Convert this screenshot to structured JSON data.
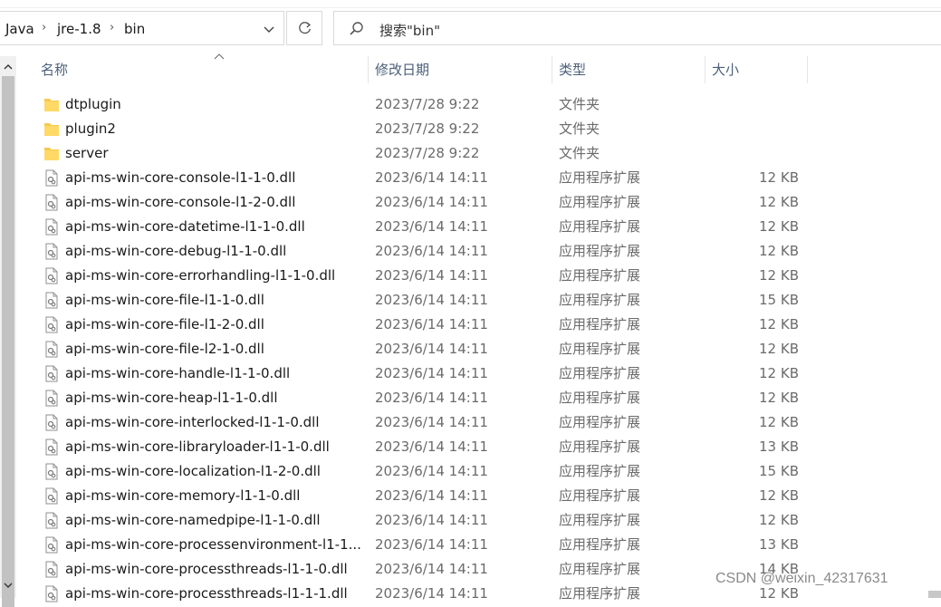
{
  "breadcrumb": [
    "Java",
    "jre-1.8",
    "bin"
  ],
  "search": {
    "placeholder": "搜索\"bin\""
  },
  "columns": {
    "name": "名称",
    "date": "修改日期",
    "type": "类型",
    "size": "大小"
  },
  "files": [
    {
      "name": "dtplugin",
      "date": "2023/7/28 9:22",
      "type": "文件夹",
      "size": "",
      "kind": "folder"
    },
    {
      "name": "plugin2",
      "date": "2023/7/28 9:22",
      "type": "文件夹",
      "size": "",
      "kind": "folder"
    },
    {
      "name": "server",
      "date": "2023/7/28 9:22",
      "type": "文件夹",
      "size": "",
      "kind": "folder"
    },
    {
      "name": "api-ms-win-core-console-l1-1-0.dll",
      "date": "2023/6/14 14:11",
      "type": "应用程序扩展",
      "size": "12 KB",
      "kind": "dll"
    },
    {
      "name": "api-ms-win-core-console-l1-2-0.dll",
      "date": "2023/6/14 14:11",
      "type": "应用程序扩展",
      "size": "12 KB",
      "kind": "dll"
    },
    {
      "name": "api-ms-win-core-datetime-l1-1-0.dll",
      "date": "2023/6/14 14:11",
      "type": "应用程序扩展",
      "size": "12 KB",
      "kind": "dll"
    },
    {
      "name": "api-ms-win-core-debug-l1-1-0.dll",
      "date": "2023/6/14 14:11",
      "type": "应用程序扩展",
      "size": "12 KB",
      "kind": "dll"
    },
    {
      "name": "api-ms-win-core-errorhandling-l1-1-0.dll",
      "date": "2023/6/14 14:11",
      "type": "应用程序扩展",
      "size": "12 KB",
      "kind": "dll"
    },
    {
      "name": "api-ms-win-core-file-l1-1-0.dll",
      "date": "2023/6/14 14:11",
      "type": "应用程序扩展",
      "size": "15 KB",
      "kind": "dll"
    },
    {
      "name": "api-ms-win-core-file-l1-2-0.dll",
      "date": "2023/6/14 14:11",
      "type": "应用程序扩展",
      "size": "12 KB",
      "kind": "dll"
    },
    {
      "name": "api-ms-win-core-file-l2-1-0.dll",
      "date": "2023/6/14 14:11",
      "type": "应用程序扩展",
      "size": "12 KB",
      "kind": "dll"
    },
    {
      "name": "api-ms-win-core-handle-l1-1-0.dll",
      "date": "2023/6/14 14:11",
      "type": "应用程序扩展",
      "size": "12 KB",
      "kind": "dll"
    },
    {
      "name": "api-ms-win-core-heap-l1-1-0.dll",
      "date": "2023/6/14 14:11",
      "type": "应用程序扩展",
      "size": "12 KB",
      "kind": "dll"
    },
    {
      "name": "api-ms-win-core-interlocked-l1-1-0.dll",
      "date": "2023/6/14 14:11",
      "type": "应用程序扩展",
      "size": "12 KB",
      "kind": "dll"
    },
    {
      "name": "api-ms-win-core-libraryloader-l1-1-0.dll",
      "date": "2023/6/14 14:11",
      "type": "应用程序扩展",
      "size": "13 KB",
      "kind": "dll"
    },
    {
      "name": "api-ms-win-core-localization-l1-2-0.dll",
      "date": "2023/6/14 14:11",
      "type": "应用程序扩展",
      "size": "15 KB",
      "kind": "dll"
    },
    {
      "name": "api-ms-win-core-memory-l1-1-0.dll",
      "date": "2023/6/14 14:11",
      "type": "应用程序扩展",
      "size": "12 KB",
      "kind": "dll"
    },
    {
      "name": "api-ms-win-core-namedpipe-l1-1-0.dll",
      "date": "2023/6/14 14:11",
      "type": "应用程序扩展",
      "size": "12 KB",
      "kind": "dll"
    },
    {
      "name": "api-ms-win-core-processenvironment-l1-1...",
      "date": "2023/6/14 14:11",
      "type": "应用程序扩展",
      "size": "13 KB",
      "kind": "dll"
    },
    {
      "name": "api-ms-win-core-processthreads-l1-1-0.dll",
      "date": "2023/6/14 14:11",
      "type": "应用程序扩展",
      "size": "14 KB",
      "kind": "dll"
    },
    {
      "name": "api-ms-win-core-processthreads-l1-1-1.dll",
      "date": "2023/6/14 14:11",
      "type": "应用程序扩展",
      "size": "12 KB",
      "kind": "dll"
    }
  ],
  "watermark": "CSDN @weixin_42317631",
  "colors": {
    "folder": "#f8c94a",
    "header_text": "#4c607a",
    "muted_text": "#6b6b6b"
  }
}
